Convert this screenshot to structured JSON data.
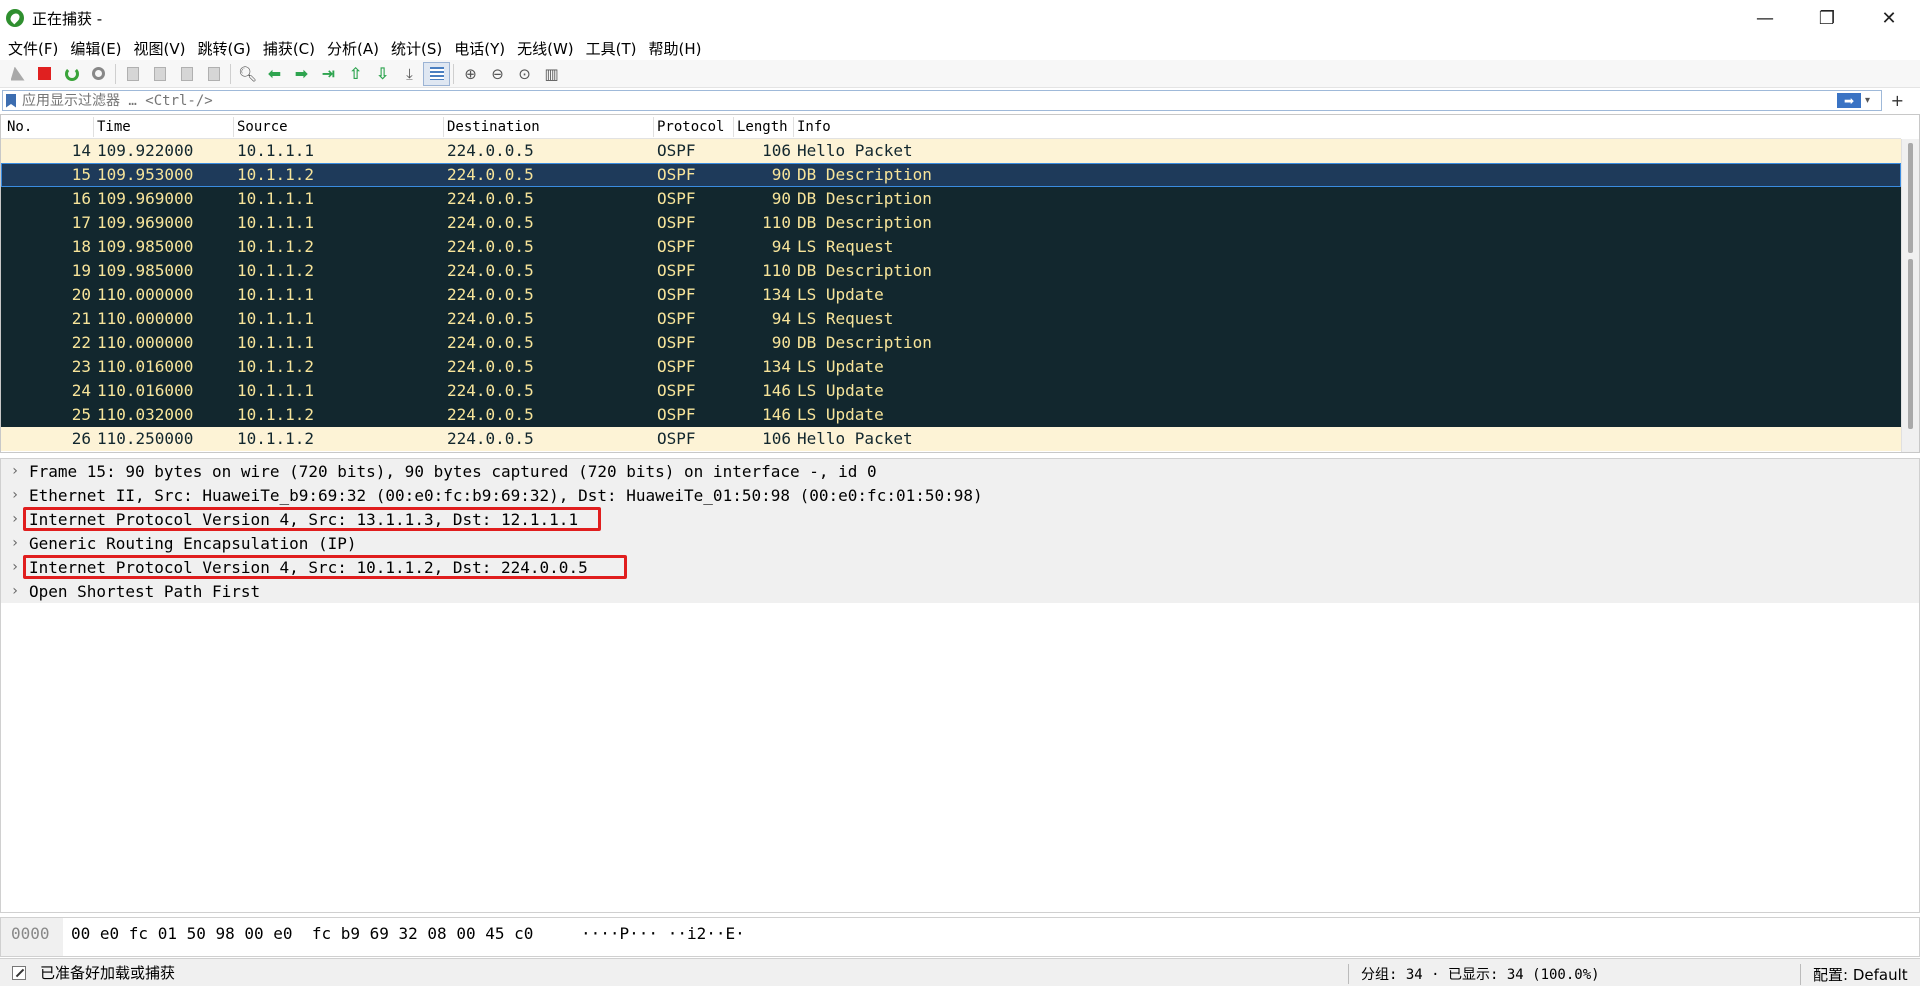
{
  "window": {
    "title": "正在捕获 -",
    "minimize": "—",
    "restore": "❐",
    "close": "✕"
  },
  "menu": [
    {
      "label": "文件(F)"
    },
    {
      "label": "编辑(E)"
    },
    {
      "label": "视图(V)"
    },
    {
      "label": "跳转(G)"
    },
    {
      "label": "捕获(C)"
    },
    {
      "label": "分析(A)"
    },
    {
      "label": "统计(S)"
    },
    {
      "label": "电话(Y)"
    },
    {
      "label": "无线(W)"
    },
    {
      "label": "工具(T)"
    },
    {
      "label": "帮助(H)"
    }
  ],
  "filter": {
    "placeholder": "应用显示过滤器 … <Ctrl-/>",
    "apply_label": "➡",
    "add_label": "+"
  },
  "packet_list": {
    "columns": {
      "no": "No.",
      "time": "Time",
      "source": "Source",
      "destination": "Destination",
      "protocol": "Protocol",
      "length": "Length",
      "info": "Info"
    },
    "rows": [
      {
        "no": "14",
        "time": "109.922000",
        "source": "10.1.1.1",
        "destination": "224.0.0.5",
        "protocol": "OSPF",
        "length": "106",
        "info": "Hello Packet",
        "style": "hello"
      },
      {
        "no": "15",
        "time": "109.953000",
        "source": "10.1.1.2",
        "destination": "224.0.0.5",
        "protocol": "OSPF",
        "length": "90",
        "info": "DB Description",
        "style": "selected"
      },
      {
        "no": "16",
        "time": "109.969000",
        "source": "10.1.1.1",
        "destination": "224.0.0.5",
        "protocol": "OSPF",
        "length": "90",
        "info": "DB Description",
        "style": "dark"
      },
      {
        "no": "17",
        "time": "109.969000",
        "source": "10.1.1.1",
        "destination": "224.0.0.5",
        "protocol": "OSPF",
        "length": "110",
        "info": "DB Description",
        "style": "dark"
      },
      {
        "no": "18",
        "time": "109.985000",
        "source": "10.1.1.2",
        "destination": "224.0.0.5",
        "protocol": "OSPF",
        "length": "94",
        "info": "LS Request",
        "style": "dark"
      },
      {
        "no": "19",
        "time": "109.985000",
        "source": "10.1.1.2",
        "destination": "224.0.0.5",
        "protocol": "OSPF",
        "length": "110",
        "info": "DB Description",
        "style": "dark"
      },
      {
        "no": "20",
        "time": "110.000000",
        "source": "10.1.1.1",
        "destination": "224.0.0.5",
        "protocol": "OSPF",
        "length": "134",
        "info": "LS Update",
        "style": "dark"
      },
      {
        "no": "21",
        "time": "110.000000",
        "source": "10.1.1.1",
        "destination": "224.0.0.5",
        "protocol": "OSPF",
        "length": "94",
        "info": "LS Request",
        "style": "dark"
      },
      {
        "no": "22",
        "time": "110.000000",
        "source": "10.1.1.1",
        "destination": "224.0.0.5",
        "protocol": "OSPF",
        "length": "90",
        "info": "DB Description",
        "style": "dark"
      },
      {
        "no": "23",
        "time": "110.016000",
        "source": "10.1.1.2",
        "destination": "224.0.0.5",
        "protocol": "OSPF",
        "length": "134",
        "info": "LS Update",
        "style": "dark"
      },
      {
        "no": "24",
        "time": "110.016000",
        "source": "10.1.1.1",
        "destination": "224.0.0.5",
        "protocol": "OSPF",
        "length": "146",
        "info": "LS Update",
        "style": "dark"
      },
      {
        "no": "25",
        "time": "110.032000",
        "source": "10.1.1.2",
        "destination": "224.0.0.5",
        "protocol": "OSPF",
        "length": "146",
        "info": "LS Update",
        "style": "dark"
      },
      {
        "no": "26",
        "time": "110.250000",
        "source": "10.1.1.2",
        "destination": "224.0.0.5",
        "protocol": "OSPF",
        "length": "106",
        "info": "Hello Packet",
        "style": "hello"
      }
    ]
  },
  "details": [
    {
      "text": "Frame 15: 90 bytes on wire (720 bits), 90 bytes captured (720 bits) on interface -, id 0",
      "highlight": false
    },
    {
      "text": "Ethernet II, Src: HuaweiTe_b9:69:32 (00:e0:fc:b9:69:32), Dst: HuaweiTe_01:50:98 (00:e0:fc:01:50:98)",
      "highlight": false
    },
    {
      "text": "Internet Protocol Version 4, Src: 13.1.1.3, Dst: 12.1.1.1",
      "highlight": true
    },
    {
      "text": "Generic Routing Encapsulation (IP)",
      "highlight": false
    },
    {
      "text": "Internet Protocol Version 4, Src: 10.1.1.2, Dst: 224.0.0.5",
      "highlight": true
    },
    {
      "text": "Open Shortest Path First",
      "highlight": false
    }
  ],
  "hex": {
    "offset": "0000",
    "bytes": "00 e0 fc 01 50 98 00 e0  fc b9 69 32 08 00 45 c0",
    "ascii": "····P··· ··i2··E·"
  },
  "status": {
    "ready": "已准备好加载或捕获",
    "stats": "分组: 34 · 已显示: 34 (100.0%)",
    "profile": "配置: Default"
  },
  "colors": {
    "hello_bg": "#fdf3d6",
    "hello_fg": "#12272e",
    "dark_bg": "#12272e",
    "dark_fg": "#f7e49a",
    "selected_bg": "#1e3a5a",
    "selected_border": "#3a8ce0",
    "highlight_border": "#e01e1e"
  }
}
